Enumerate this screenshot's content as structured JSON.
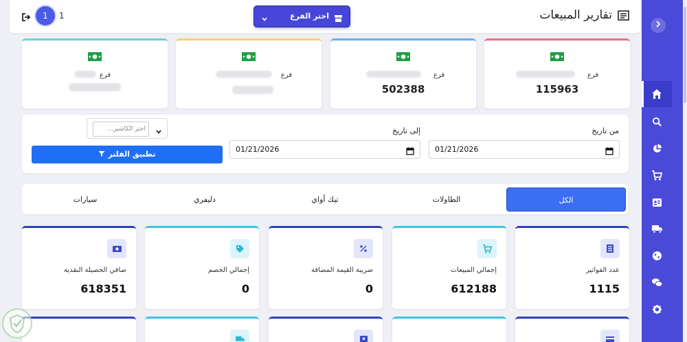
{
  "header": {
    "title": "تقارير المبيعات",
    "branch_button": "اختر الفرع",
    "page_circle": "1",
    "page_number": "1"
  },
  "branch_cards": [
    {
      "prefix": "فرع",
      "value": "115963",
      "accent": "#f06b82"
    },
    {
      "prefix": "فرع",
      "value": "502388",
      "accent": "#6ab0ec"
    },
    {
      "prefix": "فرع",
      "value": "",
      "accent": "#fad365"
    },
    {
      "prefix": "فرع",
      "value": "",
      "accent": "#6fd3d3"
    }
  ],
  "filter": {
    "from_label": "من تاريخ",
    "from_value": "01/21/2026",
    "to_label": "إلى تاريخ",
    "to_value": "01/21/2026",
    "cashier_placeholder": "اختر الكاشير...",
    "apply_label": "تطبيق الفلتر"
  },
  "tabs": [
    {
      "label": "الكل",
      "active": true
    },
    {
      "label": "الطاولات",
      "active": false
    },
    {
      "label": "تيك أواي",
      "active": false
    },
    {
      "label": "دليفري",
      "active": false
    },
    {
      "label": "سيارات",
      "active": false
    }
  ],
  "stats": [
    {
      "label": "عدد الفواتير",
      "value": "1115",
      "icon": "invoice-icon"
    },
    {
      "label": "إجمالي المبيعات",
      "value": "612188",
      "icon": "cart-icon"
    },
    {
      "label": "ضريبة القيمة المضافة",
      "value": "0",
      "icon": "percent-icon"
    },
    {
      "label": "إجمالي الخصم",
      "value": "0",
      "icon": "tag-icon"
    },
    {
      "label": "صافي الحصيلة النقدية",
      "value": "618351",
      "icon": "money-icon"
    }
  ],
  "sidebar": {
    "items": [
      "home-icon",
      "search-icon",
      "pie-chart-icon",
      "cart-icon",
      "id-card-icon",
      "truck-icon",
      "globe-icon",
      "chat-icon",
      "gear-icon"
    ]
  },
  "colors": {
    "primary": "#4a4ad8",
    "blue_button": "#1e6ff5",
    "active_tab": "#3c6ef3",
    "money_green": "#1e9e45"
  }
}
